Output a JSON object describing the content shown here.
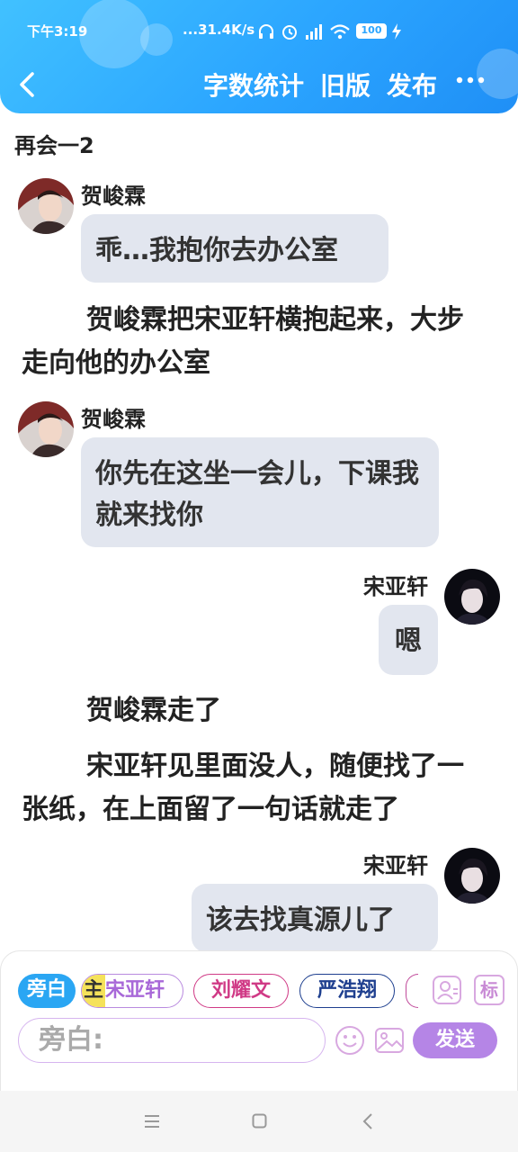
{
  "status_bar": {
    "time": "下午3:19",
    "network_speed": "...31.4K/s",
    "battery": "100"
  },
  "header": {
    "actions": [
      "字数统计",
      "旧版",
      "发布"
    ]
  },
  "chapter": {
    "title": "再会一2"
  },
  "messages": [
    {
      "type": "left",
      "name": "贺峻霖",
      "text": "乖…我抱你去办公室"
    },
    {
      "type": "narration",
      "text": "贺峻霖把宋亚轩横抱起来，大步走向他的办公室"
    },
    {
      "type": "left",
      "name": "贺峻霖",
      "text": "你先在这坐一会儿，下课我就来找你"
    },
    {
      "type": "right",
      "name": "宋亚轩",
      "text": "嗯"
    },
    {
      "type": "narration",
      "text": "贺峻霖走了"
    },
    {
      "type": "narration",
      "text": "宋亚轩见里面没人，随便找了一张纸，在上面留了一句话就走了"
    },
    {
      "type": "right",
      "name": "宋亚轩",
      "text": "该去找真源儿了"
    }
  ],
  "composer": {
    "roles": [
      {
        "label": "旁白"
      },
      {
        "badge": "主",
        "label": "宋亚轩",
        "color": "#a868d8"
      },
      {
        "label": "刘耀文",
        "color": "#d03a86"
      },
      {
        "label": "严浩翔",
        "color": "#1e3f8f"
      }
    ],
    "input_placeholder": "旁白:",
    "send_label": "发送",
    "tag_label": "标"
  },
  "colors": {
    "header_start": "#41c1ff",
    "header_end": "#1f8ff6",
    "bubble": "#e2e6ef",
    "send": "#b585e6",
    "narrator_chip": "#2aa6f3"
  }
}
